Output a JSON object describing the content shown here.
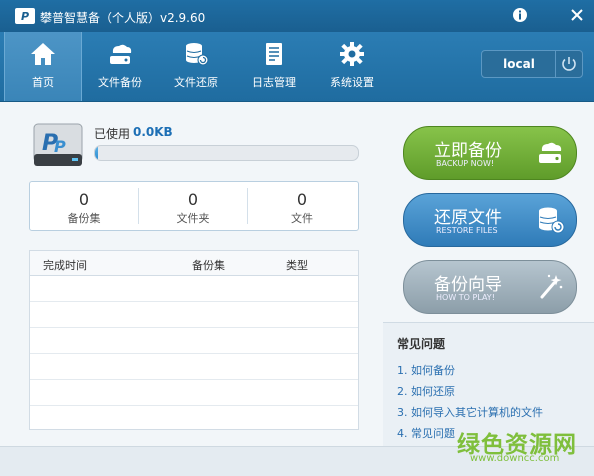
{
  "window": {
    "logo_text": "P",
    "title": "攀普智慧备（个人版）v2.9.60",
    "info_icon": "info-icon",
    "close_icon": "close-icon"
  },
  "toolbar": {
    "items": [
      {
        "label": "首页",
        "icon": "home-icon",
        "active": true
      },
      {
        "label": "文件备份",
        "icon": "cloud-drive-icon",
        "active": false
      },
      {
        "label": "文件还原",
        "icon": "database-restore-icon",
        "active": false
      },
      {
        "label": "日志管理",
        "icon": "document-icon",
        "active": false
      },
      {
        "label": "系统设置",
        "icon": "gear-icon",
        "active": false
      }
    ],
    "local_label": "local",
    "power_icon": "power-icon"
  },
  "storage": {
    "used_label": "已使用",
    "used_value": "0.0KB",
    "progress_fraction": 0.01
  },
  "stats": [
    {
      "count": "0",
      "caption": "备份集"
    },
    {
      "count": "0",
      "caption": "文件夹"
    },
    {
      "count": "0",
      "caption": "文件"
    }
  ],
  "table": {
    "headers": [
      "完成时间",
      "备份集",
      "类型"
    ],
    "rows": []
  },
  "actions": [
    {
      "label": "立即备份",
      "sub": "BACKUP NOW!",
      "icon": "cloud-drive-icon",
      "color": "#6fae35"
    },
    {
      "label": "还原文件",
      "sub": "RESTORE FILES",
      "icon": "database-restore-icon",
      "color": "#3d8ac6"
    },
    {
      "label": "备份向导",
      "sub": "HOW TO PLAY!",
      "icon": "magic-wand-icon",
      "color": "#9fb0bb"
    }
  ],
  "faq": {
    "title": "常见问题",
    "items": [
      "1. 如何备份",
      "2. 如何还原",
      "3. 如何导入其它计算机的文件",
      "4. 常见问题"
    ]
  },
  "watermark": {
    "cn": "绿色资源网",
    "url": "www.downcc.com"
  }
}
